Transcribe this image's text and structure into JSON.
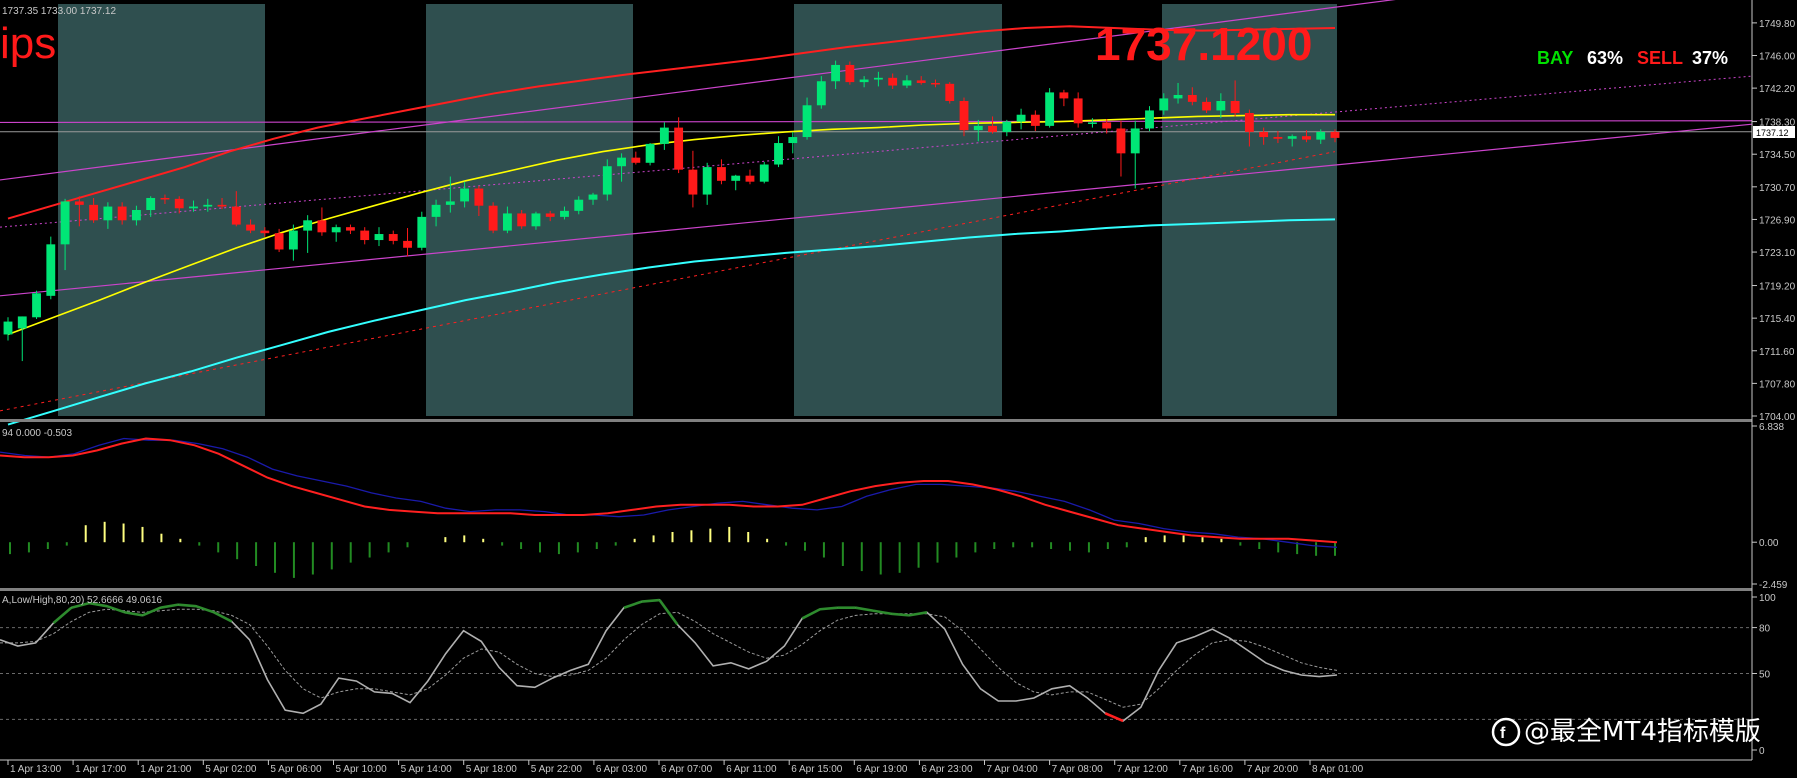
{
  "header_readout": "1737.35 1733.00 1737.12",
  "corner_text": "ips",
  "big_price": "1737.1200",
  "sentiment": {
    "buy_label": "BAY",
    "buy_pct": "63%",
    "sell_label": "SELL",
    "sell_pct": "37%"
  },
  "current_price_tag": "1737.12",
  "watermark": "@最全MT4指标模版",
  "colors": {
    "bull": "#00e676",
    "bear": "#ff1a1a",
    "ma_yellow": "#ffff00",
    "band_red": "#ff2020",
    "cyan": "#33ffff",
    "channel": "#cc44cc",
    "session": "#2f4f4f",
    "macd_blue": "#1a1aaa",
    "macd_red": "#ff2020",
    "hist_pos": "#ffff80",
    "hist_neg": "#228b22",
    "stoch_main": "#b0b0b0",
    "stoch_green": "#2e8b2e"
  },
  "chart_data": [
    {
      "type": "candlestick",
      "title": "",
      "ylim": [
        1704.0,
        1752.0
      ],
      "y_ticks": [
        "1749.80",
        "1746.00",
        "1742.20",
        "1738.30",
        "1734.50",
        "1730.70",
        "1726.90",
        "1723.10",
        "1719.20",
        "1715.40",
        "1711.60",
        "1707.80",
        "1704.00"
      ],
      "candles": [
        {
          "o": 1713.5,
          "h": 1715.5,
          "l": 1712.8,
          "c": 1715.0
        },
        {
          "o": 1714.2,
          "h": 1715.6,
          "l": 1710.4,
          "c": 1715.6
        },
        {
          "o": 1715.5,
          "h": 1718.6,
          "l": 1715.3,
          "c": 1718.3
        },
        {
          "o": 1718.0,
          "h": 1724.9,
          "l": 1717.6,
          "c": 1724.0
        },
        {
          "o": 1724.0,
          "h": 1729.3,
          "l": 1721.0,
          "c": 1729.0
        },
        {
          "o": 1729.0,
          "h": 1729.6,
          "l": 1726.1,
          "c": 1728.6
        },
        {
          "o": 1728.6,
          "h": 1729.4,
          "l": 1726.5,
          "c": 1726.8
        },
        {
          "o": 1726.8,
          "h": 1728.9,
          "l": 1725.8,
          "c": 1728.4
        },
        {
          "o": 1728.4,
          "h": 1728.9,
          "l": 1726.3,
          "c": 1726.8
        },
        {
          "o": 1726.8,
          "h": 1728.5,
          "l": 1726.2,
          "c": 1728.0
        },
        {
          "o": 1728.0,
          "h": 1729.6,
          "l": 1727.2,
          "c": 1729.4
        },
        {
          "o": 1729.4,
          "h": 1729.8,
          "l": 1728.7,
          "c": 1729.3
        },
        {
          "o": 1729.3,
          "h": 1729.6,
          "l": 1727.6,
          "c": 1728.2
        },
        {
          "o": 1728.2,
          "h": 1729.1,
          "l": 1727.8,
          "c": 1728.4
        },
        {
          "o": 1728.4,
          "h": 1729.3,
          "l": 1727.8,
          "c": 1728.6
        },
        {
          "o": 1728.6,
          "h": 1729.4,
          "l": 1728.1,
          "c": 1728.4
        },
        {
          "o": 1728.4,
          "h": 1730.2,
          "l": 1726.1,
          "c": 1726.3
        },
        {
          "o": 1726.3,
          "h": 1726.9,
          "l": 1725.3,
          "c": 1725.6
        },
        {
          "o": 1725.6,
          "h": 1726.0,
          "l": 1724.9,
          "c": 1725.3
        },
        {
          "o": 1725.3,
          "h": 1725.8,
          "l": 1723.1,
          "c": 1723.4
        },
        {
          "o": 1723.4,
          "h": 1726.3,
          "l": 1722.1,
          "c": 1725.6
        },
        {
          "o": 1725.6,
          "h": 1727.4,
          "l": 1723.0,
          "c": 1726.8
        },
        {
          "o": 1726.8,
          "h": 1728.3,
          "l": 1725.0,
          "c": 1725.4
        },
        {
          "o": 1725.4,
          "h": 1726.3,
          "l": 1724.3,
          "c": 1726.0
        },
        {
          "o": 1726.0,
          "h": 1726.3,
          "l": 1725.2,
          "c": 1725.6
        },
        {
          "o": 1725.6,
          "h": 1726.0,
          "l": 1724.0,
          "c": 1724.5
        },
        {
          "o": 1724.5,
          "h": 1726.0,
          "l": 1723.8,
          "c": 1725.2
        },
        {
          "o": 1725.2,
          "h": 1725.6,
          "l": 1724.0,
          "c": 1724.4
        },
        {
          "o": 1724.4,
          "h": 1725.9,
          "l": 1722.6,
          "c": 1723.6
        },
        {
          "o": 1723.6,
          "h": 1727.8,
          "l": 1723.3,
          "c": 1727.2
        },
        {
          "o": 1727.2,
          "h": 1729.2,
          "l": 1726.1,
          "c": 1728.6
        },
        {
          "o": 1728.6,
          "h": 1731.9,
          "l": 1727.7,
          "c": 1729.0
        },
        {
          "o": 1729.0,
          "h": 1731.3,
          "l": 1728.3,
          "c": 1730.5
        },
        {
          "o": 1730.5,
          "h": 1730.8,
          "l": 1727.3,
          "c": 1728.5
        },
        {
          "o": 1728.5,
          "h": 1728.9,
          "l": 1725.3,
          "c": 1725.6
        },
        {
          "o": 1725.6,
          "h": 1728.4,
          "l": 1725.3,
          "c": 1727.6
        },
        {
          "o": 1727.6,
          "h": 1728.0,
          "l": 1725.8,
          "c": 1726.1
        },
        {
          "o": 1726.1,
          "h": 1727.8,
          "l": 1725.7,
          "c": 1727.6
        },
        {
          "o": 1727.6,
          "h": 1727.9,
          "l": 1726.7,
          "c": 1727.2
        },
        {
          "o": 1727.2,
          "h": 1728.4,
          "l": 1726.9,
          "c": 1727.9
        },
        {
          "o": 1727.9,
          "h": 1729.6,
          "l": 1727.5,
          "c": 1729.2
        },
        {
          "o": 1729.2,
          "h": 1730.0,
          "l": 1728.6,
          "c": 1729.8
        },
        {
          "o": 1729.8,
          "h": 1733.9,
          "l": 1729.1,
          "c": 1733.1
        },
        {
          "o": 1733.1,
          "h": 1734.6,
          "l": 1731.3,
          "c": 1734.1
        },
        {
          "o": 1734.1,
          "h": 1734.8,
          "l": 1733.3,
          "c": 1733.5
        },
        {
          "o": 1733.5,
          "h": 1735.8,
          "l": 1733.2,
          "c": 1735.7
        },
        {
          "o": 1735.7,
          "h": 1738.2,
          "l": 1735.0,
          "c": 1737.6
        },
        {
          "o": 1737.6,
          "h": 1738.8,
          "l": 1732.3,
          "c": 1732.7
        },
        {
          "o": 1732.7,
          "h": 1734.9,
          "l": 1728.3,
          "c": 1729.8
        },
        {
          "o": 1729.8,
          "h": 1733.5,
          "l": 1728.6,
          "c": 1733.0
        },
        {
          "o": 1733.0,
          "h": 1733.9,
          "l": 1731.0,
          "c": 1731.4
        },
        {
          "o": 1731.4,
          "h": 1732.1,
          "l": 1730.3,
          "c": 1732.0
        },
        {
          "o": 1732.0,
          "h": 1732.7,
          "l": 1731.0,
          "c": 1731.3
        },
        {
          "o": 1731.3,
          "h": 1733.6,
          "l": 1731.1,
          "c": 1733.3
        },
        {
          "o": 1733.3,
          "h": 1736.6,
          "l": 1733.0,
          "c": 1735.8
        },
        {
          "o": 1735.8,
          "h": 1737.1,
          "l": 1734.6,
          "c": 1736.5
        },
        {
          "o": 1736.5,
          "h": 1741.1,
          "l": 1736.2,
          "c": 1740.2
        },
        {
          "o": 1740.2,
          "h": 1743.6,
          "l": 1739.8,
          "c": 1743.0
        },
        {
          "o": 1743.0,
          "h": 1745.4,
          "l": 1742.1,
          "c": 1744.9
        },
        {
          "o": 1744.9,
          "h": 1745.3,
          "l": 1742.6,
          "c": 1742.9
        },
        {
          "o": 1742.9,
          "h": 1743.6,
          "l": 1742.3,
          "c": 1743.2
        },
        {
          "o": 1743.2,
          "h": 1744.1,
          "l": 1742.4,
          "c": 1743.4
        },
        {
          "o": 1743.4,
          "h": 1743.9,
          "l": 1742.1,
          "c": 1742.5
        },
        {
          "o": 1742.5,
          "h": 1743.7,
          "l": 1742.2,
          "c": 1743.1
        },
        {
          "o": 1743.1,
          "h": 1743.6,
          "l": 1742.6,
          "c": 1742.8
        },
        {
          "o": 1742.8,
          "h": 1743.2,
          "l": 1742.3,
          "c": 1742.7
        },
        {
          "o": 1742.7,
          "h": 1742.9,
          "l": 1740.4,
          "c": 1740.7
        },
        {
          "o": 1740.7,
          "h": 1741.1,
          "l": 1736.6,
          "c": 1737.3
        },
        {
          "o": 1737.3,
          "h": 1738.5,
          "l": 1736.0,
          "c": 1737.8
        },
        {
          "o": 1737.8,
          "h": 1738.9,
          "l": 1736.9,
          "c": 1737.1
        },
        {
          "o": 1737.1,
          "h": 1738.5,
          "l": 1736.6,
          "c": 1738.3
        },
        {
          "o": 1738.3,
          "h": 1739.8,
          "l": 1737.4,
          "c": 1739.1
        },
        {
          "o": 1739.1,
          "h": 1739.6,
          "l": 1737.2,
          "c": 1737.8
        },
        {
          "o": 1737.8,
          "h": 1742.2,
          "l": 1737.6,
          "c": 1741.7
        },
        {
          "o": 1741.7,
          "h": 1742.0,
          "l": 1740.1,
          "c": 1741.0
        },
        {
          "o": 1741.0,
          "h": 1741.7,
          "l": 1737.6,
          "c": 1738.1
        },
        {
          "o": 1738.1,
          "h": 1738.7,
          "l": 1737.6,
          "c": 1738.2
        },
        {
          "o": 1738.2,
          "h": 1738.6,
          "l": 1736.9,
          "c": 1737.5
        },
        {
          "o": 1737.5,
          "h": 1738.4,
          "l": 1731.9,
          "c": 1734.6
        },
        {
          "o": 1734.6,
          "h": 1738.4,
          "l": 1730.5,
          "c": 1737.5
        },
        {
          "o": 1737.5,
          "h": 1740.1,
          "l": 1737.2,
          "c": 1739.6
        },
        {
          "o": 1739.6,
          "h": 1741.6,
          "l": 1739.1,
          "c": 1741.0
        },
        {
          "o": 1741.0,
          "h": 1742.8,
          "l": 1740.4,
          "c": 1741.4
        },
        {
          "o": 1741.4,
          "h": 1742.3,
          "l": 1740.2,
          "c": 1740.6
        },
        {
          "o": 1740.6,
          "h": 1741.1,
          "l": 1739.3,
          "c": 1739.6
        },
        {
          "o": 1739.6,
          "h": 1741.6,
          "l": 1738.7,
          "c": 1740.7
        },
        {
          "o": 1740.7,
          "h": 1743.1,
          "l": 1738.9,
          "c": 1739.3
        },
        {
          "o": 1739.3,
          "h": 1739.7,
          "l": 1735.4,
          "c": 1737.1
        },
        {
          "o": 1737.1,
          "h": 1737.6,
          "l": 1735.6,
          "c": 1736.5
        },
        {
          "o": 1736.5,
          "h": 1737.2,
          "l": 1735.8,
          "c": 1736.3
        },
        {
          "o": 1736.3,
          "h": 1736.8,
          "l": 1735.4,
          "c": 1736.6
        },
        {
          "o": 1736.6,
          "h": 1737.3,
          "l": 1735.9,
          "c": 1736.2
        },
        {
          "o": 1736.2,
          "h": 1737.4,
          "l": 1735.7,
          "c": 1737.1
        },
        {
          "o": 1737.1,
          "h": 1737.4,
          "l": 1735.9,
          "c": 1736.4
        }
      ]
    },
    {
      "type": "line",
      "title": "94 0.000 -0.503",
      "ylim": [
        -2.459,
        6.838
      ],
      "y_ticks": [
        "6.838",
        "0.00",
        "-2.459"
      ],
      "blue_line": [
        5.3,
        5.1,
        5.0,
        5.2,
        5.7,
        6.1,
        6.0,
        6.0,
        5.8,
        5.5,
        5.0,
        4.3,
        3.9,
        3.6,
        3.3,
        2.9,
        2.6,
        2.4,
        2.0,
        1.8,
        1.9,
        1.9,
        1.8,
        1.6,
        1.6,
        1.5,
        1.6,
        1.9,
        2.1,
        2.3,
        2.4,
        2.2,
        2.0,
        1.9,
        2.1,
        2.7,
        3.1,
        3.4,
        3.4,
        3.3,
        3.2,
        3.0,
        2.7,
        2.4,
        1.9,
        1.3,
        1.1,
        0.8,
        0.6,
        0.5,
        0.3,
        0.2,
        0.0,
        -0.2,
        -0.3
      ],
      "red_line": [
        5.1,
        5.0,
        5.0,
        5.1,
        5.4,
        5.8,
        6.1,
        6.0,
        5.7,
        5.2,
        4.5,
        3.8,
        3.3,
        2.9,
        2.5,
        2.1,
        1.9,
        1.8,
        1.7,
        1.7,
        1.7,
        1.7,
        1.6,
        1.6,
        1.6,
        1.7,
        1.9,
        2.1,
        2.2,
        2.2,
        2.2,
        2.1,
        2.1,
        2.2,
        2.6,
        3.0,
        3.3,
        3.5,
        3.6,
        3.6,
        3.4,
        3.1,
        2.7,
        2.2,
        1.8,
        1.4,
        1.0,
        0.8,
        0.6,
        0.4,
        0.3,
        0.2,
        0.2,
        0.2,
        0.1,
        0.0
      ],
      "histogram": [
        -0.7,
        -0.6,
        -0.4,
        -0.2,
        1.0,
        1.2,
        1.1,
        0.9,
        0.5,
        0.2,
        -0.2,
        -0.6,
        -1.0,
        -1.4,
        -1.8,
        -2.1,
        -1.9,
        -1.6,
        -1.2,
        -0.9,
        -0.6,
        -0.3,
        0.0,
        0.3,
        0.4,
        0.2,
        -0.2,
        -0.4,
        -0.6,
        -0.7,
        -0.6,
        -0.4,
        -0.2,
        0.2,
        0.4,
        0.6,
        0.7,
        0.8,
        0.9,
        0.6,
        0.2,
        -0.2,
        -0.5,
        -0.9,
        -1.4,
        -1.7,
        -1.9,
        -1.8,
        -1.5,
        -1.2,
        -0.9,
        -0.6,
        -0.4,
        -0.3,
        -0.3,
        -0.4,
        -0.5,
        -0.6,
        -0.4,
        -0.3,
        0.3,
        0.4,
        0.4,
        0.3,
        0.2,
        -0.2,
        -0.4,
        -0.6,
        -0.7,
        -0.8,
        -0.8
      ]
    },
    {
      "type": "line",
      "title": "A,Low/High,80,20) 52.6666 49.0616",
      "ylim": [
        0,
        100
      ],
      "y_ticks": [
        "100",
        "80",
        "50",
        "0"
      ],
      "levels": [
        80,
        50,
        20
      ],
      "main_line": [
        72,
        68,
        70,
        83,
        93,
        96,
        94,
        90,
        88,
        93,
        95,
        94,
        90,
        84,
        72,
        46,
        26,
        24,
        30,
        47,
        45,
        38,
        37,
        31,
        45,
        63,
        78,
        71,
        54,
        42,
        41,
        47,
        52,
        56,
        78,
        93,
        97,
        98,
        82,
        70,
        55,
        57,
        53,
        58,
        68,
        86,
        92,
        93,
        93,
        91,
        89,
        88,
        90,
        79,
        56,
        40,
        32,
        32,
        34,
        40,
        42,
        34,
        24,
        19,
        28,
        52,
        70,
        74,
        79,
        73,
        65,
        57,
        52,
        49,
        48,
        49
      ],
      "signal_line": [
        70,
        70,
        71,
        76,
        84,
        90,
        92,
        91,
        90,
        91,
        92,
        92,
        91,
        88,
        82,
        68,
        52,
        40,
        34,
        38,
        40,
        40,
        38,
        36,
        40,
        49,
        60,
        66,
        64,
        56,
        50,
        48,
        49,
        52,
        60,
        72,
        82,
        89,
        90,
        84,
        76,
        70,
        64,
        60,
        62,
        69,
        78,
        85,
        88,
        89,
        89,
        89,
        89,
        87,
        78,
        66,
        54,
        44,
        38,
        36,
        38,
        38,
        33,
        28,
        30,
        40,
        52,
        62,
        70,
        72,
        71,
        67,
        62,
        57,
        54,
        52
      ]
    }
  ],
  "time_axis": [
    "1 Apr 13:00",
    "1 Apr 17:00",
    "1 Apr 21:00",
    "5 Apr 02:00",
    "5 Apr 06:00",
    "5 Apr 10:00",
    "5 Apr 14:00",
    "5 Apr 18:00",
    "5 Apr 22:00",
    "6 Apr 03:00",
    "6 Apr 07:00",
    "6 Apr 11:00",
    "6 Apr 15:00",
    "6 Apr 19:00",
    "6 Apr 23:00",
    "7 Apr 04:00",
    "7 Apr 08:00",
    "7 Apr 12:00",
    "7 Apr 16:00",
    "7 Apr 20:00",
    "8 Apr 01:00"
  ]
}
